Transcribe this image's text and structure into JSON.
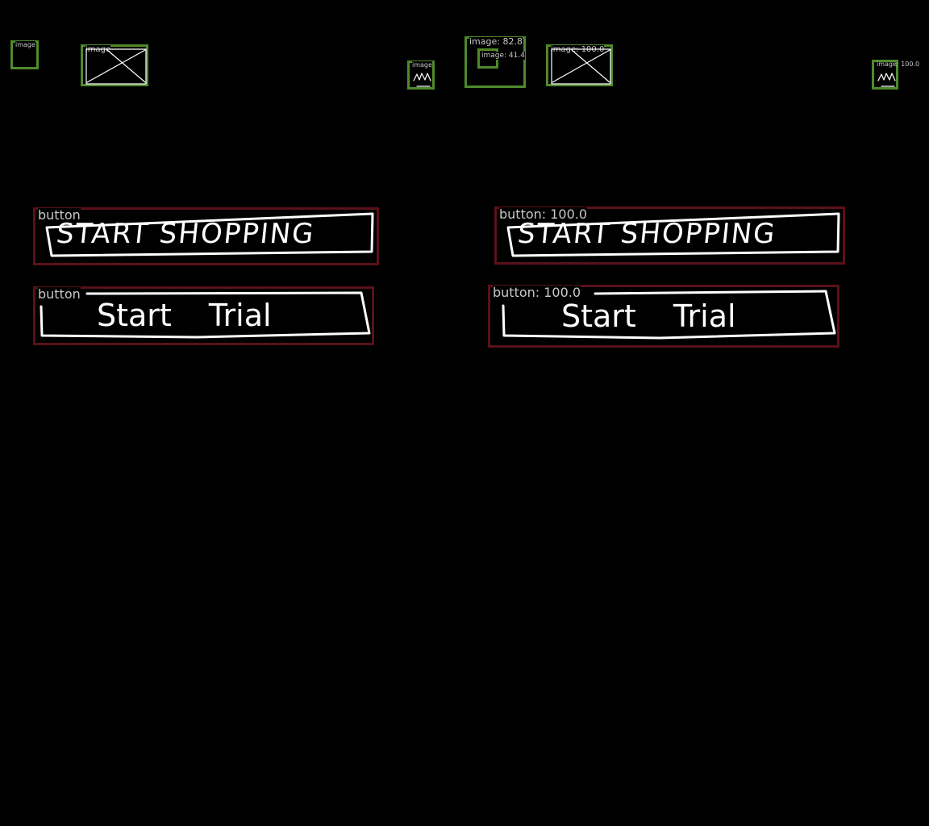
{
  "left_panel": {
    "images": [
      {
        "label": "image"
      },
      {
        "label": "image"
      },
      {
        "label": "image"
      }
    ],
    "buttons": [
      {
        "label": "button",
        "sketch_text": "START SHOPPING"
      },
      {
        "label": "button",
        "sketch_text": "Start Trial"
      }
    ]
  },
  "right_panel": {
    "images": [
      {
        "label": "image: 82.8",
        "inner_label": "image: 41.4"
      },
      {
        "label": "image: 100.0"
      },
      {
        "label": "image: 100.0"
      }
    ],
    "buttons": [
      {
        "label": "button: 100.0",
        "sketch_text": "START SHOPPING"
      },
      {
        "label": "button: 100.0",
        "sketch_text": "Start Trial"
      }
    ]
  },
  "colors": {
    "image_box": "#4f8a2b",
    "button_box": "#5a1119",
    "background": "#000000",
    "label_text": "#c8c8c8",
    "sketch_stroke": "#ffffff"
  }
}
